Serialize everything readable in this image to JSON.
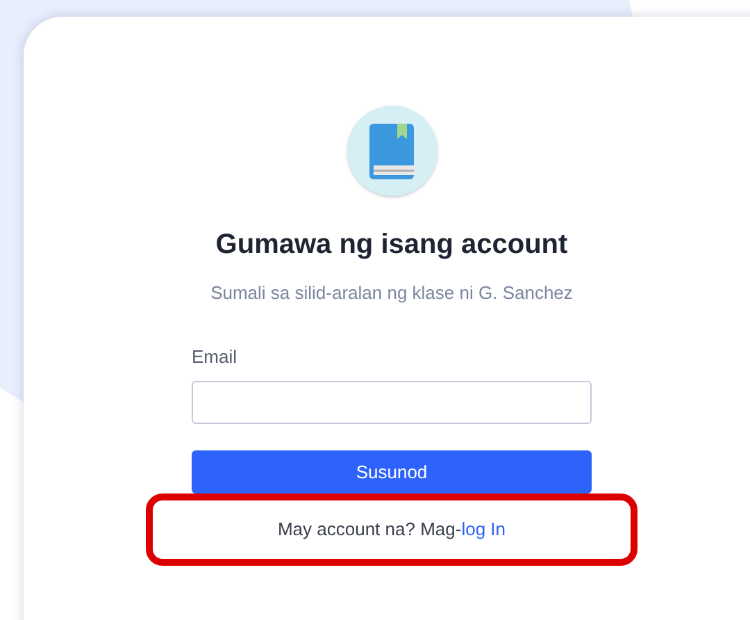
{
  "title": "Gumawa ng isang account",
  "subtitle": "Sumali sa silid-aralan ng klase ni G. Sanchez",
  "email": {
    "label": "Email"
  },
  "submit": "Susunod",
  "footer": {
    "text": "May account na? Mag-",
    "link": "log In",
    "highlighted": true
  }
}
